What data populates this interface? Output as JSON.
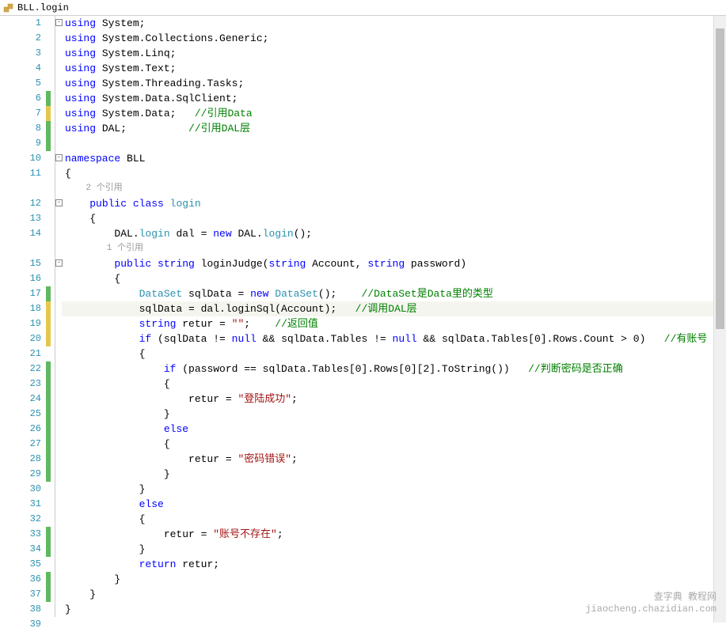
{
  "tab": {
    "title": "BLL.login"
  },
  "codelens": {
    "refs_class": "2 个引用",
    "refs_method": "1 个引用"
  },
  "lines": [
    {
      "num": 1,
      "change": "",
      "outline": "box",
      "tokens": [
        {
          "t": "kw",
          "v": "using"
        },
        {
          "t": "plain",
          "v": " System;"
        }
      ]
    },
    {
      "num": 2,
      "change": "",
      "outline": "line",
      "tokens": [
        {
          "t": "kw",
          "v": "using"
        },
        {
          "t": "plain",
          "v": " System.Collections.Generic;"
        }
      ]
    },
    {
      "num": 3,
      "change": "",
      "outline": "line",
      "tokens": [
        {
          "t": "kw",
          "v": "using"
        },
        {
          "t": "plain",
          "v": " System.Linq;"
        }
      ]
    },
    {
      "num": 4,
      "change": "",
      "outline": "line",
      "tokens": [
        {
          "t": "kw",
          "v": "using"
        },
        {
          "t": "plain",
          "v": " System.Text;"
        }
      ]
    },
    {
      "num": 5,
      "change": "",
      "outline": "line",
      "tokens": [
        {
          "t": "kw",
          "v": "using"
        },
        {
          "t": "plain",
          "v": " System.Threading.Tasks;"
        }
      ]
    },
    {
      "num": 6,
      "change": "green",
      "outline": "line",
      "tokens": [
        {
          "t": "kw",
          "v": "using"
        },
        {
          "t": "plain",
          "v": " System.Data.SqlClient;"
        }
      ]
    },
    {
      "num": 7,
      "change": "yellow",
      "outline": "line",
      "tokens": [
        {
          "t": "kw",
          "v": "using"
        },
        {
          "t": "plain",
          "v": " System.Data;   "
        },
        {
          "t": "comment",
          "v": "//引用Data"
        }
      ]
    },
    {
      "num": 8,
      "change": "green",
      "outline": "line",
      "tokens": [
        {
          "t": "kw",
          "v": "using"
        },
        {
          "t": "plain",
          "v": " DAL;          "
        },
        {
          "t": "comment",
          "v": "//引用DAL层"
        }
      ]
    },
    {
      "num": 9,
      "change": "green",
      "outline": "line",
      "tokens": []
    },
    {
      "num": 10,
      "change": "",
      "outline": "box",
      "tokens": [
        {
          "t": "kw",
          "v": "namespace"
        },
        {
          "t": "plain",
          "v": " BLL"
        }
      ]
    },
    {
      "num": 11,
      "change": "",
      "outline": "line",
      "tokens": [
        {
          "t": "plain",
          "v": "{"
        }
      ]
    },
    {
      "codelens": "refs_class",
      "pad": 4
    },
    {
      "num": 12,
      "change": "",
      "outline": "box",
      "tokens": [
        {
          "t": "plain",
          "v": "    "
        },
        {
          "t": "kw",
          "v": "public"
        },
        {
          "t": "plain",
          "v": " "
        },
        {
          "t": "kw",
          "v": "class"
        },
        {
          "t": "plain",
          "v": " "
        },
        {
          "t": "type",
          "v": "login"
        }
      ]
    },
    {
      "num": 13,
      "change": "",
      "outline": "line",
      "tokens": [
        {
          "t": "plain",
          "v": "    {"
        }
      ]
    },
    {
      "num": 14,
      "change": "",
      "outline": "line",
      "tokens": [
        {
          "t": "plain",
          "v": "        DAL."
        },
        {
          "t": "type",
          "v": "login"
        },
        {
          "t": "plain",
          "v": " dal = "
        },
        {
          "t": "kw",
          "v": "new"
        },
        {
          "t": "plain",
          "v": " DAL."
        },
        {
          "t": "type",
          "v": "login"
        },
        {
          "t": "plain",
          "v": "();"
        }
      ]
    },
    {
      "codelens": "refs_method",
      "pad": 8
    },
    {
      "num": 15,
      "change": "",
      "outline": "box",
      "tokens": [
        {
          "t": "plain",
          "v": "        "
        },
        {
          "t": "kw",
          "v": "public"
        },
        {
          "t": "plain",
          "v": " "
        },
        {
          "t": "kw",
          "v": "string"
        },
        {
          "t": "plain",
          "v": " loginJudge("
        },
        {
          "t": "kw",
          "v": "string"
        },
        {
          "t": "plain",
          "v": " Account, "
        },
        {
          "t": "kw",
          "v": "string"
        },
        {
          "t": "plain",
          "v": " password)"
        }
      ]
    },
    {
      "num": 16,
      "change": "",
      "outline": "line",
      "tokens": [
        {
          "t": "plain",
          "v": "        {"
        }
      ]
    },
    {
      "num": 17,
      "change": "green",
      "outline": "line",
      "tokens": [
        {
          "t": "plain",
          "v": "            "
        },
        {
          "t": "type",
          "v": "DataSet"
        },
        {
          "t": "plain",
          "v": " sqlData = "
        },
        {
          "t": "kw",
          "v": "new"
        },
        {
          "t": "plain",
          "v": " "
        },
        {
          "t": "type",
          "v": "DataSet"
        },
        {
          "t": "plain",
          "v": "();    "
        },
        {
          "t": "comment",
          "v": "//DataSet是Data里的类型"
        }
      ]
    },
    {
      "num": 18,
      "change": "yellow",
      "outline": "line",
      "highlight": true,
      "tokens": [
        {
          "t": "plain",
          "v": "            sqlData = dal.loginSql(Account);   "
        },
        {
          "t": "comment",
          "v": "//调用DAL层"
        }
      ]
    },
    {
      "num": 19,
      "change": "yellow",
      "outline": "line",
      "tokens": [
        {
          "t": "plain",
          "v": "            "
        },
        {
          "t": "kw",
          "v": "string"
        },
        {
          "t": "plain",
          "v": " retur = "
        },
        {
          "t": "str",
          "v": "\"\""
        },
        {
          "t": "plain",
          "v": ";    "
        },
        {
          "t": "comment",
          "v": "//返回值"
        }
      ]
    },
    {
      "num": 20,
      "change": "yellow",
      "outline": "line",
      "tokens": [
        {
          "t": "plain",
          "v": "            "
        },
        {
          "t": "kw",
          "v": "if"
        },
        {
          "t": "plain",
          "v": " (sqlData != "
        },
        {
          "t": "kw",
          "v": "null"
        },
        {
          "t": "plain",
          "v": " && sqlData.Tables != "
        },
        {
          "t": "kw",
          "v": "null"
        },
        {
          "t": "plain",
          "v": " && sqlData.Tables[0].Rows.Count > 0)   "
        },
        {
          "t": "comment",
          "v": "//有账号"
        }
      ]
    },
    {
      "num": 21,
      "change": "",
      "outline": "line",
      "tokens": [
        {
          "t": "plain",
          "v": "            {"
        }
      ]
    },
    {
      "num": 22,
      "change": "green",
      "outline": "line",
      "tokens": [
        {
          "t": "plain",
          "v": "                "
        },
        {
          "t": "kw",
          "v": "if"
        },
        {
          "t": "plain",
          "v": " (password == sqlData.Tables[0].Rows[0][2].ToString())   "
        },
        {
          "t": "comment",
          "v": "//判断密码是否正确"
        }
      ]
    },
    {
      "num": 23,
      "change": "green",
      "outline": "line",
      "tokens": [
        {
          "t": "plain",
          "v": "                {"
        }
      ]
    },
    {
      "num": 24,
      "change": "green",
      "outline": "line",
      "tokens": [
        {
          "t": "plain",
          "v": "                    retur = "
        },
        {
          "t": "str",
          "v": "\"登陆成功\""
        },
        {
          "t": "plain",
          "v": ";"
        }
      ]
    },
    {
      "num": 25,
      "change": "green",
      "outline": "line",
      "tokens": [
        {
          "t": "plain",
          "v": "                }"
        }
      ]
    },
    {
      "num": 26,
      "change": "green",
      "outline": "line",
      "tokens": [
        {
          "t": "plain",
          "v": "                "
        },
        {
          "t": "kw",
          "v": "else"
        }
      ]
    },
    {
      "num": 27,
      "change": "green",
      "outline": "line",
      "tokens": [
        {
          "t": "plain",
          "v": "                {"
        }
      ]
    },
    {
      "num": 28,
      "change": "green",
      "outline": "line",
      "tokens": [
        {
          "t": "plain",
          "v": "                    retur = "
        },
        {
          "t": "str",
          "v": "\"密码错误\""
        },
        {
          "t": "plain",
          "v": ";"
        }
      ]
    },
    {
      "num": 29,
      "change": "green",
      "outline": "line",
      "tokens": [
        {
          "t": "plain",
          "v": "                }"
        }
      ]
    },
    {
      "num": 30,
      "change": "",
      "outline": "line",
      "tokens": [
        {
          "t": "plain",
          "v": "            }"
        }
      ]
    },
    {
      "num": 31,
      "change": "",
      "outline": "line",
      "tokens": [
        {
          "t": "plain",
          "v": "            "
        },
        {
          "t": "kw",
          "v": "else"
        }
      ]
    },
    {
      "num": 32,
      "change": "",
      "outline": "line",
      "tokens": [
        {
          "t": "plain",
          "v": "            {"
        }
      ]
    },
    {
      "num": 33,
      "change": "green",
      "outline": "line",
      "tokens": [
        {
          "t": "plain",
          "v": "                retur = "
        },
        {
          "t": "str",
          "v": "\"账号不存在\""
        },
        {
          "t": "plain",
          "v": ";"
        }
      ]
    },
    {
      "num": 34,
      "change": "green",
      "outline": "line",
      "tokens": [
        {
          "t": "plain",
          "v": "            }"
        }
      ]
    },
    {
      "num": 35,
      "change": "",
      "outline": "line",
      "tokens": [
        {
          "t": "plain",
          "v": "            "
        },
        {
          "t": "kw",
          "v": "return"
        },
        {
          "t": "plain",
          "v": " retur;"
        }
      ]
    },
    {
      "num": 36,
      "change": "green",
      "outline": "line",
      "tokens": [
        {
          "t": "plain",
          "v": "        }"
        }
      ]
    },
    {
      "num": 37,
      "change": "green",
      "outline": "line",
      "tokens": [
        {
          "t": "plain",
          "v": "    }"
        }
      ]
    },
    {
      "num": 38,
      "change": "",
      "outline": "line",
      "tokens": [
        {
          "t": "plain",
          "v": "}"
        }
      ]
    },
    {
      "num": 39,
      "change": "",
      "outline": "",
      "tokens": []
    }
  ],
  "watermark": {
    "line1": "查字典 教程网",
    "line2": "jiaocheng.chazidian.com"
  }
}
